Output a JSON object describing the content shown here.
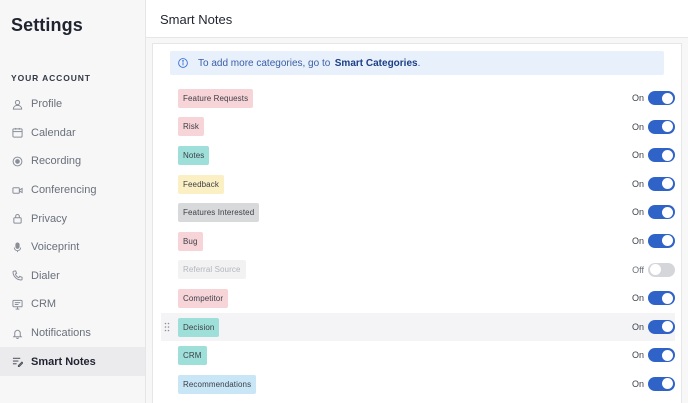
{
  "sidebar": {
    "title": "Settings",
    "section_label": "YOUR ACCOUNT",
    "items": [
      {
        "label": "Profile",
        "icon": "user-icon"
      },
      {
        "label": "Calendar",
        "icon": "calendar-icon"
      },
      {
        "label": "Recording",
        "icon": "record-icon"
      },
      {
        "label": "Conferencing",
        "icon": "video-icon"
      },
      {
        "label": "Privacy",
        "icon": "lock-icon"
      },
      {
        "label": "Voiceprint",
        "icon": "microphone-icon"
      },
      {
        "label": "Dialer",
        "icon": "phone-icon"
      },
      {
        "label": "CRM",
        "icon": "crm-icon"
      },
      {
        "label": "Notifications",
        "icon": "bell-icon"
      },
      {
        "label": "Smart Notes",
        "icon": "notes-icon",
        "active": true
      }
    ]
  },
  "main": {
    "title": "Smart Notes",
    "info_banner": {
      "text": "To add more categories, go to ",
      "link": "Smart Categories",
      "suffix": "."
    },
    "categories": [
      {
        "label": "Feature Requests",
        "color": "#f7d4d8",
        "state": "On"
      },
      {
        "label": "Risk",
        "color": "#f7d4d8",
        "state": "On"
      },
      {
        "label": "Notes",
        "color": "#9edfd9",
        "state": "On"
      },
      {
        "label": "Feedback",
        "color": "#fbefc4",
        "state": "On"
      },
      {
        "label": "Features Interested",
        "color": "#d8d9db",
        "state": "On"
      },
      {
        "label": "Bug",
        "color": "#f7d4d8",
        "state": "On"
      },
      {
        "label": "Referral Source",
        "color": "#f2f2f3",
        "state": "Off",
        "disabled": true
      },
      {
        "label": "Competitor",
        "color": "#f7d4d8",
        "state": "On"
      },
      {
        "label": "Decision",
        "color": "#9edfd9",
        "state": "On",
        "hover": true
      },
      {
        "label": "CRM",
        "color": "#9edfd9",
        "state": "On"
      },
      {
        "label": "Recommendations",
        "color": "#c9e6f7",
        "state": "On"
      }
    ]
  }
}
